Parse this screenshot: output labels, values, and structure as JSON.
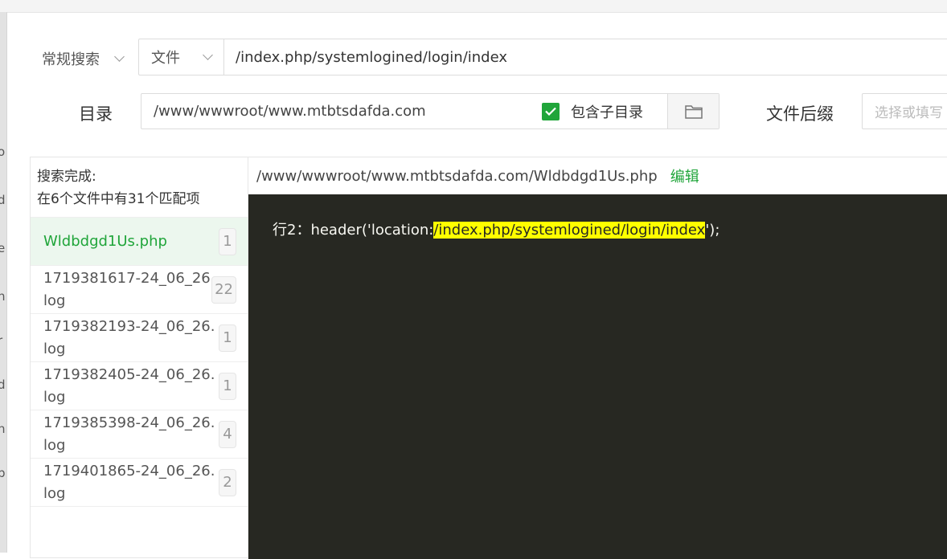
{
  "search": {
    "mode_label": "常规搜索",
    "scope_label": "文件",
    "query_value": "/index.php/systemlogined/login/index"
  },
  "directory": {
    "label": "目录",
    "path_value": "/www/wwwroot/www.mtbtsdafda.com",
    "include_subdirs_label": "包含子目录",
    "include_subdirs_checked": true
  },
  "extension": {
    "label": "文件后缀",
    "placeholder": "选择或填写"
  },
  "summary": {
    "line1": "搜索完成:",
    "line2": "在6个文件中有31个匹配项"
  },
  "files": [
    {
      "name": "Wldbdgd1Us.php",
      "count": "1",
      "active": true
    },
    {
      "name": "1719381617-24_06_26.log",
      "count": "22",
      "active": false
    },
    {
      "name": "1719382193-24_06_26.log",
      "count": "1",
      "active": false
    },
    {
      "name": "1719382405-24_06_26.log",
      "count": "1",
      "active": false
    },
    {
      "name": "1719385398-24_06_26.log",
      "count": "4",
      "active": false
    },
    {
      "name": "1719401865-24_06_26.log",
      "count": "2",
      "active": false
    }
  ],
  "preview": {
    "file_path": "/www/wwwroot/www.mtbtsdafda.com/Wldbdgd1Us.php",
    "edit_label": "编辑",
    "line_prefix": "行2：header('location:",
    "line_match": "/index.php/systemlogined/login/index",
    "line_suffix": "');"
  },
  "colors": {
    "accent": "#20a53a",
    "code_bg": "#272822",
    "highlight": "#ffff00"
  }
}
